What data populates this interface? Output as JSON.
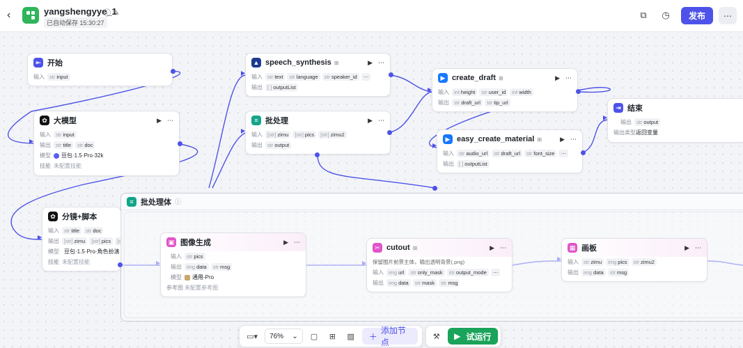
{
  "header": {
    "title": "yangshengyye_1",
    "autosave": "已自动保存 15:30:27",
    "publish_label": "发布"
  },
  "nodes": {
    "start": {
      "title": "开始",
      "input_label": "输入",
      "params": [
        {
          "type": "str",
          "name": "input"
        }
      ]
    },
    "llm": {
      "title": "大模型",
      "input_label": "输入",
      "output_label": "输出",
      "model_label": "模型",
      "skill_label": "技能",
      "inputs": [
        {
          "type": "str",
          "name": "input"
        }
      ],
      "outputs": [
        {
          "type": "str",
          "name": "title"
        },
        {
          "type": "str",
          "name": "doc"
        }
      ],
      "model": "豆包·1.5·Pro·32k",
      "skill": "未配置技能"
    },
    "speech": {
      "title": "speech_synthesis",
      "input_label": "输入",
      "output_label": "输出",
      "inputs": [
        {
          "type": "str",
          "name": "text"
        },
        {
          "type": "str",
          "name": "language"
        },
        {
          "type": "str",
          "name": "speaker_id"
        }
      ],
      "outputs": [
        {
          "type": "[ ]",
          "name": "outputList"
        }
      ]
    },
    "batch": {
      "title": "批处理",
      "input_label": "输入",
      "output_label": "输出",
      "inputs": [
        {
          "type": "[str]",
          "name": "zimu"
        },
        {
          "type": "[str]",
          "name": "pics"
        },
        {
          "type": "[str]",
          "name": "zimu2"
        }
      ],
      "outputs": [
        {
          "type": "str",
          "name": "output"
        }
      ]
    },
    "draft": {
      "title": "create_draft",
      "input_label": "输入",
      "output_label": "输出",
      "inputs": [
        {
          "type": "int",
          "name": "height"
        },
        {
          "type": "str",
          "name": "user_id"
        },
        {
          "type": "int",
          "name": "width"
        }
      ],
      "outputs": [
        {
          "type": "str",
          "name": "draft_url"
        },
        {
          "type": "str",
          "name": "tip_url"
        }
      ]
    },
    "material": {
      "title": "easy_create_material",
      "input_label": "输入",
      "output_label": "输出",
      "inputs": [
        {
          "type": "str",
          "name": "audio_url"
        },
        {
          "type": "str",
          "name": "draft_url"
        },
        {
          "type": "str",
          "name": "font_size"
        }
      ],
      "outputs": [
        {
          "type": "[ ]",
          "name": "outputList"
        }
      ]
    },
    "end": {
      "title": "结束",
      "output_label": "输出",
      "output_type_label": "输出类型",
      "outputs": [
        {
          "type": "str",
          "name": "output"
        }
      ],
      "output_type": "返回变量"
    },
    "script": {
      "title": "分镜+脚本",
      "input_label": "输入",
      "output_label": "输出",
      "model_label": "模型",
      "skill_label": "技能",
      "inputs": [
        {
          "type": "str",
          "name": "title"
        },
        {
          "type": "str",
          "name": "doc"
        }
      ],
      "outputs": [
        {
          "type": "[str]",
          "name": "zimu"
        },
        {
          "type": "[str]",
          "name": "pics"
        },
        {
          "type": "[str]",
          "name": "zim"
        }
      ],
      "model": "豆包·1.5·Pro·角色扮演",
      "skill": "未配置技能"
    },
    "batch_group": {
      "title": "批处理体"
    },
    "imagegen": {
      "title": "图像生成",
      "input_label": "输入",
      "output_label": "输出",
      "model_label": "模型",
      "ref_label": "参考图",
      "inputs": [
        {
          "type": "str",
          "name": "pics"
        }
      ],
      "outputs": [
        {
          "type": "img",
          "name": "data"
        },
        {
          "type": "str",
          "name": "msg"
        }
      ],
      "model": "通用-Pro",
      "ref": "未配置参考图"
    },
    "cutout": {
      "title": "cutout",
      "desc": "保留图片前景主体，输出透明背景(.png)",
      "input_label": "输入",
      "output_label": "输出",
      "inputs": [
        {
          "type": "img",
          "name": "url"
        },
        {
          "type": "str",
          "name": "only_mask"
        },
        {
          "type": "str",
          "name": "output_mode"
        }
      ],
      "outputs": [
        {
          "type": "img",
          "name": "data"
        },
        {
          "type": "str",
          "name": "mask"
        },
        {
          "type": "str",
          "name": "msg"
        }
      ]
    },
    "canvas": {
      "title": "画板",
      "input_label": "输入",
      "output_label": "输出",
      "inputs": [
        {
          "type": "str",
          "name": "zimu"
        },
        {
          "type": "img",
          "name": "pics"
        },
        {
          "type": "str",
          "name": "zimu2"
        }
      ],
      "outputs": [
        {
          "type": "img",
          "name": "data"
        },
        {
          "type": "str",
          "name": "msg"
        }
      ]
    }
  },
  "toolbar": {
    "zoom": "76%",
    "add_node": "添加节点",
    "run": "试运行"
  },
  "colors": {
    "accent": "#4d53e8",
    "run": "#1aa35a",
    "logo": "#2fb55b"
  }
}
